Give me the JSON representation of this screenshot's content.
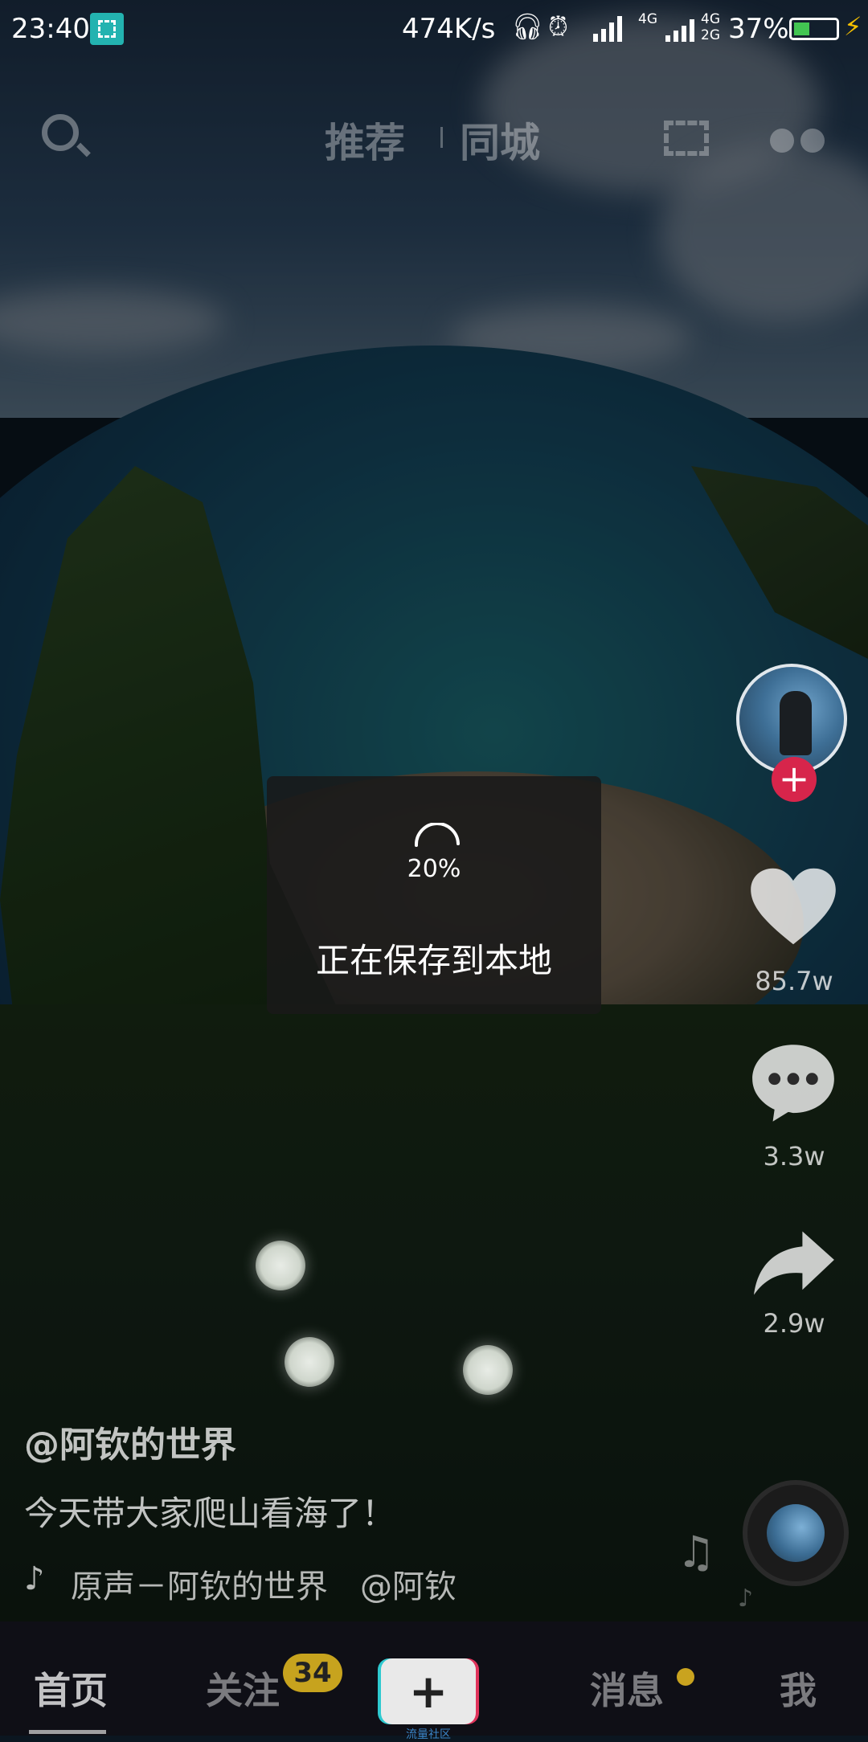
{
  "status_bar": {
    "time": "23:40",
    "net_speed": "474K/s",
    "network_1": "4G",
    "network_2": "4G 2G",
    "battery_percent": "37%",
    "battery_level": 0.37,
    "icons": [
      "screenshot-scan-icon",
      "headphones-icon",
      "alarm-icon",
      "signal-icon",
      "signal-icon",
      "battery-icon",
      "charging-icon"
    ]
  },
  "top_nav": {
    "tabs": [
      {
        "label": "推荐",
        "active": true
      },
      {
        "label": "同城",
        "active": false
      }
    ],
    "icons": [
      "search-icon",
      "scan-icon",
      "glasses-icon"
    ]
  },
  "right_rail": {
    "likes": "85.7w",
    "comments": "3.3w",
    "shares": "2.9w",
    "follow_symbol": "+"
  },
  "toast": {
    "progress_text": "20%",
    "progress": 0.2,
    "message": "正在保存到本地"
  },
  "video_info": {
    "author": "@阿钦的世界",
    "caption": "今天带大家爬山看海了！",
    "music": "​原声－阿钦的世界　@阿钦"
  },
  "bottom_nav": {
    "items": [
      {
        "label": "首页",
        "active": true
      },
      {
        "label": "关注",
        "badge": "34"
      },
      {
        "label": "+",
        "sub": "流量社区"
      },
      {
        "label": "消息",
        "dot": true
      },
      {
        "label": "我"
      }
    ]
  },
  "colors": {
    "accent_red": "#d7254b",
    "badge_gold": "#c7a31e",
    "battery_green": "#42c552",
    "teal": "#2ec9d0"
  }
}
